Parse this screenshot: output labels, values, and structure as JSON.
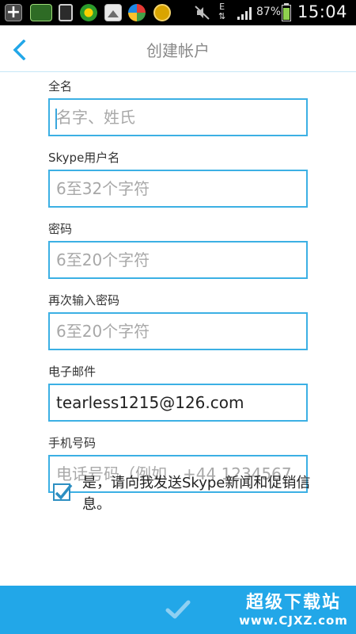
{
  "status_bar": {
    "notification_icons": [
      "add-icon",
      "battery-app-icon",
      "phone-icon",
      "browser-icon",
      "gallery-icon",
      "app-store-icon",
      "app-icon"
    ],
    "mute_icon": "mute-icon",
    "network_type": "E",
    "battery_percent": "87%",
    "battery_level": 0.87,
    "time": "15:04"
  },
  "header": {
    "title": "创建帐户",
    "back_icon": "chevron-left-icon"
  },
  "form": {
    "fields": [
      {
        "label": "全名",
        "value": "",
        "placeholder": "名字、姓氏"
      },
      {
        "label": "Skype用户名",
        "value": "",
        "placeholder": "6至32个字符"
      },
      {
        "label": "密码",
        "value": "",
        "placeholder": "6至20个字符"
      },
      {
        "label": "再次输入密码",
        "value": "",
        "placeholder": "6至20个字符"
      },
      {
        "label": "电子邮件",
        "value": "tearless1215@126.com",
        "placeholder": ""
      },
      {
        "label": "手机号码",
        "value": "",
        "placeholder": "电话号码（例如，+44 1234567"
      }
    ]
  },
  "consent": {
    "checked": true,
    "text": "是，请向我发送Skype新闻和促销信息。"
  },
  "bottom_bar": {
    "confirm_icon": "checkmark-icon",
    "watermark_line1": "超级下载站",
    "watermark_line2": "www.CJXZ.com"
  },
  "colors": {
    "accent": "#22a7e8",
    "input_border": "#3cb0e4",
    "label_text": "#333333",
    "placeholder_text": "#a8a8a8",
    "title_text": "#8a8a8a"
  }
}
